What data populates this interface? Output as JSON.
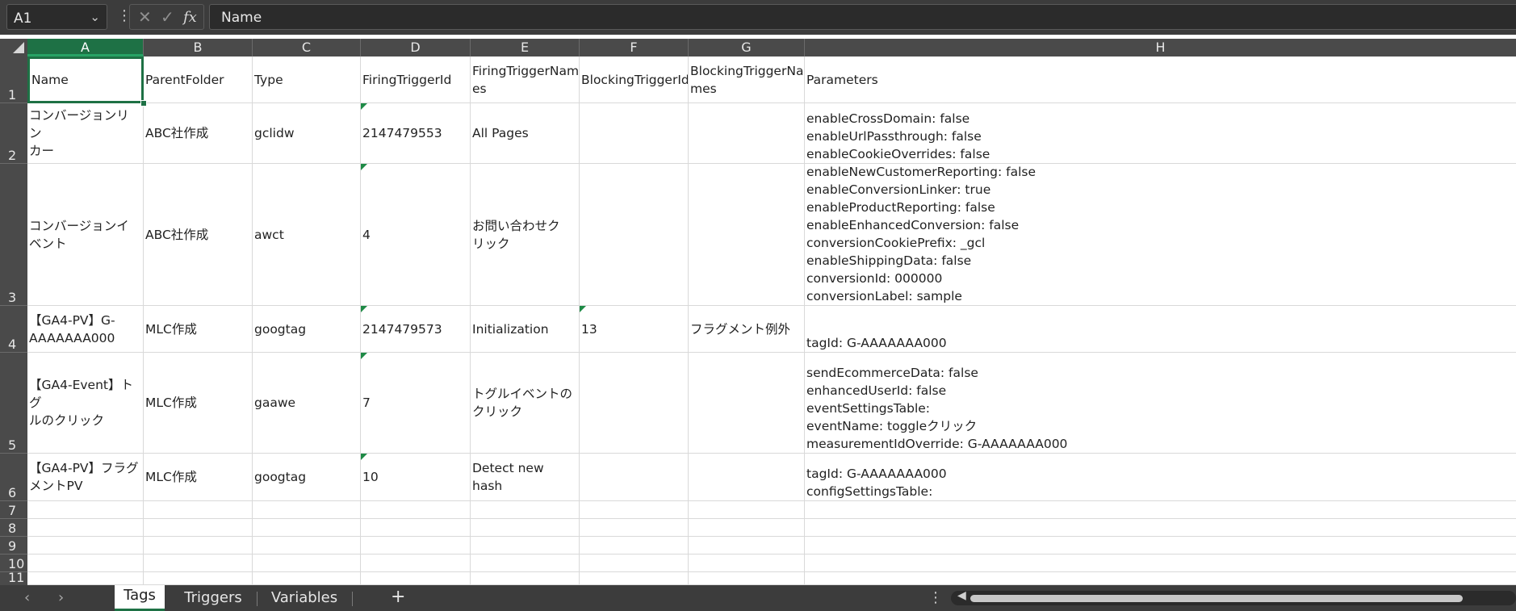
{
  "formula_bar": {
    "name_box": "A1",
    "dots": "⋮",
    "cancel_icon": "✕",
    "enter_icon": "✓",
    "fx_label": "fx",
    "formula": "Name"
  },
  "columns": [
    "A",
    "B",
    "C",
    "D",
    "E",
    "F",
    "G",
    "H"
  ],
  "rows": [
    "1",
    "2",
    "3",
    "4",
    "5",
    "6",
    "7",
    "8",
    "9",
    "10",
    "11"
  ],
  "cells": {
    "r1": [
      "Name",
      "ParentFolder",
      "Type",
      "FiringTriggerId",
      "FiringTriggerNam\nes",
      "BlockingTriggerId",
      "BlockingTriggerNa\nmes",
      "Parameters"
    ],
    "r2": [
      "コンバージョンリン\nカー",
      "ABC社作成",
      "gclidw",
      "2147479553",
      "All Pages",
      "",
      "",
      "enableCrossDomain: false\nenableUrlPassthrough: false\nenableCookieOverrides: false"
    ],
    "r3": [
      "コンバージョンイ\nベント",
      "ABC社作成",
      "awct",
      "4",
      "お問い合わせク\nリック",
      "",
      "",
      "enableNewCustomerReporting: false\nenableConversionLinker: true\nenableProductReporting: false\nenableEnhancedConversion: false\nconversionCookiePrefix: _gcl\nenableShippingData: false\nconversionId: 000000\nconversionLabel: sample"
    ],
    "r4": [
      "【GA4-PV】G-\nAAAAAAA000",
      "MLC作成",
      "googtag",
      "2147479573",
      "Initialization",
      "13",
      "フラグメント例外",
      "tagId: G-AAAAAAA000"
    ],
    "r5": [
      "【GA4-Event】トグ\nルのクリック",
      "MLC作成",
      "gaawe",
      "7",
      "トグルイベントの\nクリック",
      "",
      "",
      "sendEcommerceData: false\nenhancedUserId: false\neventSettingsTable:\neventName: toggleクリック\nmeasurementIdOverride: G-AAAAAAA000"
    ],
    "r6": [
      "【GA4-PV】フラグ\nメントPV",
      "MLC作成",
      "googtag",
      "10",
      "Detect new hash",
      "",
      "",
      "tagId: G-AAAAAAA000\nconfigSettingsTable:"
    ]
  },
  "tabs": {
    "prev": "‹",
    "next": "›",
    "sheets": [
      "Tags",
      "Triggers",
      "Variables"
    ],
    "active": "Tags",
    "add": "+",
    "more": "⋮"
  },
  "colors": {
    "accent": "#1e7145",
    "header_bg": "#4a4a4a",
    "bar_bg": "#3c3c3c"
  }
}
